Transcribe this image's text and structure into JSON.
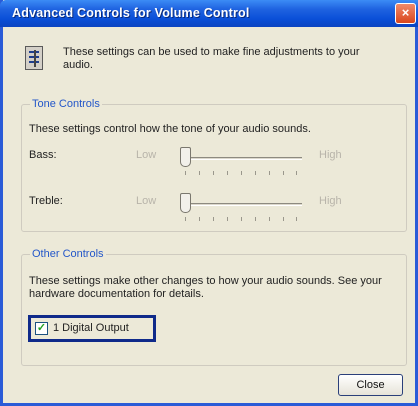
{
  "window": {
    "title": "Advanced Controls for Volume Control",
    "close_glyph": "×"
  },
  "header": {
    "icon": "mixer-panel-icon",
    "text": "These settings can be used to make fine adjustments to your audio."
  },
  "tone_controls": {
    "legend": "Tone Controls",
    "description": "These settings control how the tone of your audio sounds.",
    "bass": {
      "label": "Bass:",
      "low": "Low",
      "high": "High",
      "level": 0.0
    },
    "treble": {
      "label": "Treble:",
      "low": "Low",
      "high": "High",
      "level": 0.0
    }
  },
  "other_controls": {
    "legend": "Other Controls",
    "description": "These settings make other changes to how your audio sounds. See your hardware documentation for details.",
    "checkbox": {
      "label": "1  Digital Output",
      "checked": true
    }
  },
  "buttons": {
    "close": "Close"
  },
  "colors": {
    "title_bar": "#0a4fd8",
    "dialog_bg": "#ece9d8",
    "group_legend": "#2457c9",
    "highlight_box": "#0f2a8a",
    "check_mark": "#21a121"
  }
}
